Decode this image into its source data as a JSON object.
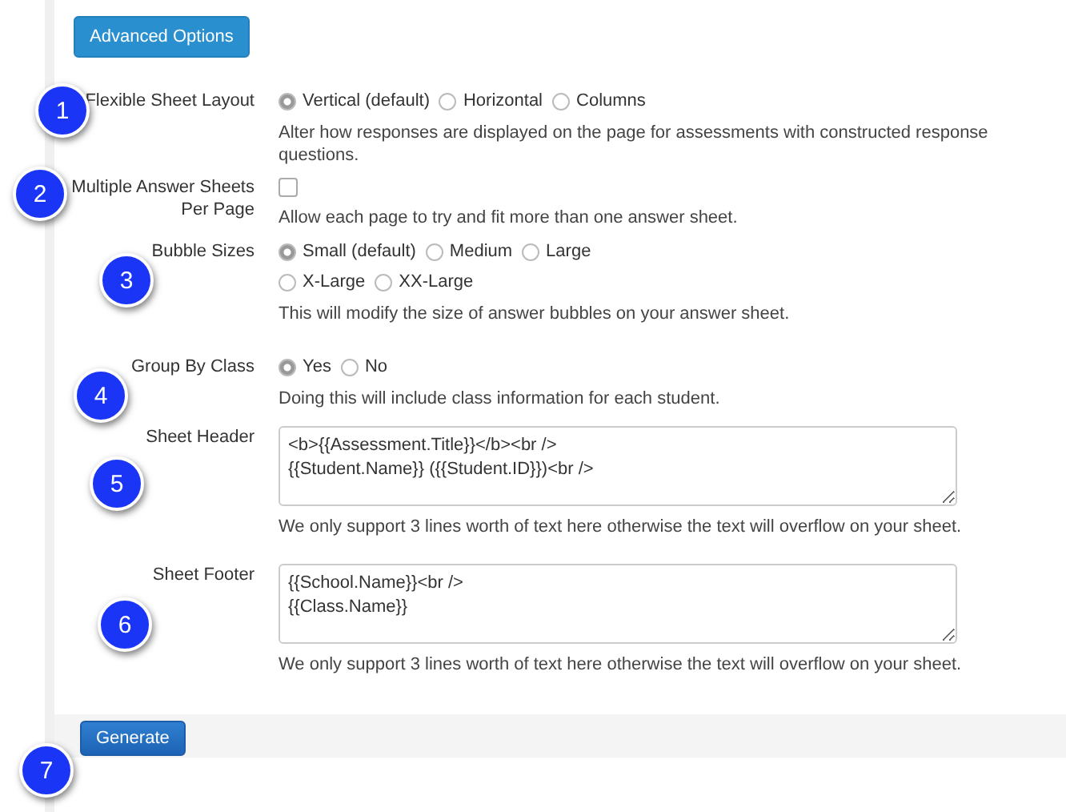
{
  "advanced_button": "Advanced Options",
  "fields": [
    {
      "kind": "radio",
      "label": "Flexible Sheet Layout",
      "marker": "1",
      "options": [
        {
          "label": "Vertical (default)",
          "selected": true
        },
        {
          "label": "Horizontal",
          "selected": false
        },
        {
          "label": "Columns",
          "selected": false
        }
      ],
      "description": "Alter how responses are displayed on the page for assessments with constructed response questions."
    },
    {
      "kind": "checkbox",
      "label": "Multiple Answer Sheets Per Page",
      "marker": "2",
      "checked": false,
      "description": "Allow each page to try and fit more than one answer sheet."
    },
    {
      "kind": "radio",
      "label": "Bubble Sizes",
      "marker": "3",
      "options": [
        {
          "label": "Small (default)",
          "selected": true
        },
        {
          "label": "Medium",
          "selected": false
        },
        {
          "label": "Large",
          "selected": false
        },
        {
          "label": "X-Large",
          "selected": false
        },
        {
          "label": "XX-Large",
          "selected": false
        }
      ],
      "description": "This will modify the size of answer bubbles on your answer sheet."
    },
    {
      "kind": "radio",
      "label": "Group By Class",
      "marker": "4",
      "options": [
        {
          "label": "Yes",
          "selected": true
        },
        {
          "label": "No",
          "selected": false
        }
      ],
      "description": "Doing this will include class information for each student."
    },
    {
      "kind": "textarea",
      "label": "Sheet Header",
      "marker": "5",
      "value": "<b>{{Assessment.Title}}</b><br />\n{{Student.Name}} ({{Student.ID}})<br />",
      "description": "We only support 3 lines worth of text here otherwise the text will overflow on your sheet."
    },
    {
      "kind": "textarea",
      "label": "Sheet Footer",
      "marker": "6",
      "value": "{{School.Name}}<br />\n{{Class.Name}}",
      "description": "We only support 3 lines worth of text here otherwise the text will overflow on your sheet."
    }
  ],
  "generate_button": "Generate",
  "generate_marker": "7"
}
